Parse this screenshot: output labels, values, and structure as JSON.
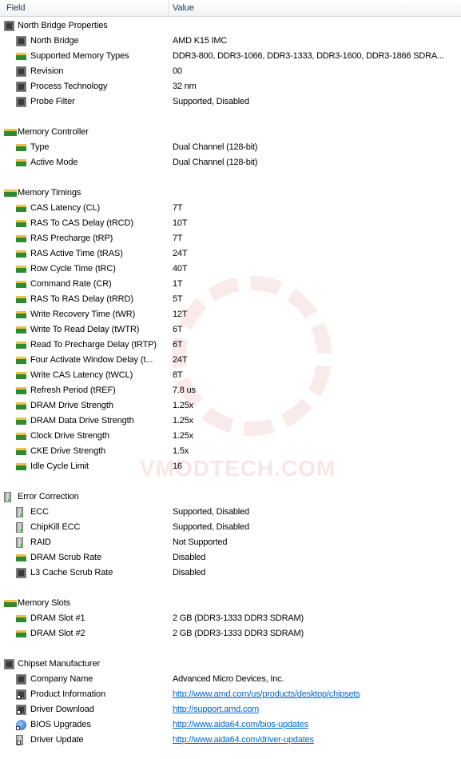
{
  "header": {
    "field": "Field",
    "value": "Value"
  },
  "watermark": "VMODTECH.COM",
  "colors": {
    "link": "#0066cc",
    "header_text": "#1e395b"
  },
  "groups": [
    {
      "label": "North Bridge Properties",
      "icon": "chip",
      "items": [
        {
          "field": "North Bridge",
          "value": "AMD K15 IMC",
          "icon": "chip"
        },
        {
          "field": "Supported Memory Types",
          "value": "DDR3-800, DDR3-1066, DDR3-1333, DDR3-1600, DDR3-1866 SDRA...",
          "icon": "ram"
        },
        {
          "field": "Revision",
          "value": "00",
          "icon": "chip"
        },
        {
          "field": "Process Technology",
          "value": "32 nm",
          "icon": "chip"
        },
        {
          "field": "Probe Filter",
          "value": "Supported, Disabled",
          "icon": "chip"
        }
      ]
    },
    {
      "label": "Memory Controller",
      "icon": "ram",
      "items": [
        {
          "field": "Type",
          "value": "Dual Channel  (128-bit)",
          "icon": "ram"
        },
        {
          "field": "Active Mode",
          "value": "Dual Channel  (128-bit)",
          "icon": "ram"
        }
      ]
    },
    {
      "label": "Memory Timings",
      "icon": "ram",
      "items": [
        {
          "field": "CAS Latency (CL)",
          "value": "7T",
          "icon": "ram"
        },
        {
          "field": "RAS To CAS Delay (tRCD)",
          "value": "10T",
          "icon": "ram"
        },
        {
          "field": "RAS Precharge (tRP)",
          "value": "7T",
          "icon": "ram"
        },
        {
          "field": "RAS Active Time (tRAS)",
          "value": "24T",
          "icon": "ram"
        },
        {
          "field": "Row Cycle Time (tRC)",
          "value": "40T",
          "icon": "ram"
        },
        {
          "field": "Command Rate (CR)",
          "value": "1T",
          "icon": "ram"
        },
        {
          "field": "RAS To RAS Delay (tRRD)",
          "value": "5T",
          "icon": "ram"
        },
        {
          "field": "Write Recovery Time (tWR)",
          "value": "12T",
          "icon": "ram"
        },
        {
          "field": "Write To Read Delay (tWTR)",
          "value": "6T",
          "icon": "ram"
        },
        {
          "field": "Read To Precharge Delay (tRTP)",
          "value": "6T",
          "icon": "ram"
        },
        {
          "field": "Four Activate Window Delay (t...",
          "value": "24T",
          "icon": "ram"
        },
        {
          "field": "Write CAS Latency (tWCL)",
          "value": "8T",
          "icon": "ram"
        },
        {
          "field": "Refresh Period (tREF)",
          "value": "7.8 us",
          "icon": "ram"
        },
        {
          "field": "DRAM Drive Strength",
          "value": "1.25x",
          "icon": "ram"
        },
        {
          "field": "DRAM Data Drive Strength",
          "value": "1.25x",
          "icon": "ram"
        },
        {
          "field": "Clock Drive Strength",
          "value": "1.25x",
          "icon": "ram"
        },
        {
          "field": "CKE Drive Strength",
          "value": "1.5x",
          "icon": "ram"
        },
        {
          "field": "Idle Cycle Limit",
          "value": "16",
          "icon": "ram"
        }
      ]
    },
    {
      "label": "Error Correction",
      "icon": "server",
      "items": [
        {
          "field": "ECC",
          "value": "Supported, Disabled",
          "icon": "server"
        },
        {
          "field": "ChipKill ECC",
          "value": "Supported, Disabled",
          "icon": "server"
        },
        {
          "field": "RAID",
          "value": "Not Supported",
          "icon": "server"
        },
        {
          "field": "DRAM Scrub Rate",
          "value": "Disabled",
          "icon": "ram"
        },
        {
          "field": "L3 Cache Scrub Rate",
          "value": "Disabled",
          "icon": "chip"
        }
      ]
    },
    {
      "label": "Memory Slots",
      "icon": "ram",
      "items": [
        {
          "field": "DRAM Slot #1",
          "value": "2 GB  (DDR3-1333 DDR3 SDRAM)",
          "icon": "ram"
        },
        {
          "field": "DRAM Slot #2",
          "value": "2 GB  (DDR3-1333 DDR3 SDRAM)",
          "icon": "ram"
        }
      ]
    },
    {
      "label": "Chipset Manufacturer",
      "icon": "chip",
      "items": [
        {
          "field": "Company Name",
          "value": "Advanced Micro Devices, Inc.",
          "icon": "chip"
        },
        {
          "field": "Product Information",
          "value": "http://www.amd.com/us/products/desktop/chipsets",
          "icon": "chip link",
          "link": true
        },
        {
          "field": "Driver Download",
          "value": "http://support.amd.com",
          "icon": "chip link",
          "link": true
        },
        {
          "field": "BIOS Upgrades",
          "value": "http://www.aida64.com/bios-updates",
          "icon": "globe link",
          "link": true
        },
        {
          "field": "Driver Update",
          "value": "http://www.aida64.com/driver-updates",
          "icon": "server link",
          "link": true
        }
      ]
    }
  ]
}
